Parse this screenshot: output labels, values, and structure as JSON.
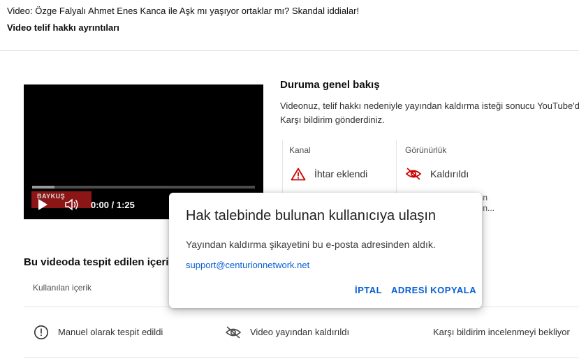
{
  "header": {
    "subtitle": "Video: Özge Falyalı Ahmet Enes Kanca ile Aşk mı yaşıyor ortaklar mı? Skandal iddialar!",
    "title": "Video telif hakkı ayrıntıları"
  },
  "video": {
    "watermark": "BAYKUŞ",
    "time": "0:00 / 1:25",
    "progress_fraction": 0.1
  },
  "overview": {
    "title": "Duruma genel bakış",
    "line1": "Videonuz, telif hakkı nedeniyle yayından kaldırma isteği sonucu YouTube'da",
    "line2": "Karşı bildirim gönderdiniz.",
    "channel": {
      "label": "Kanal",
      "value": "İhtar eklendi",
      "icon": "warning-icon",
      "color": "#cc0000"
    },
    "visibility": {
      "label": "Görünürlük",
      "value": "Kaldırıldı",
      "icon": "eye-off-icon",
      "color": "#cc0000"
    },
    "peek_line1": "ın",
    "peek_line2": "ın..."
  },
  "detected": {
    "title": "Bu videoda tespit edilen içerikle",
    "column_header": "Kullanılan içerik",
    "row": {
      "detection": "Manuel olarak tespit edildi",
      "status": "Video yayından kaldırıldı",
      "state": "Karşı bildirim incelenmeyi bekliyor"
    }
  },
  "dialog": {
    "title": "Hak talebinde bulunan kullanıcıya ulaşın",
    "body": "Yayından kaldırma şikayetini bu e-posta adresinden aldık.",
    "email": "support@centurionnetwork.net",
    "cancel_label": "İPTAL",
    "copy_label": "ADRESİ KOPYALA",
    "accent": "#065fd4"
  }
}
